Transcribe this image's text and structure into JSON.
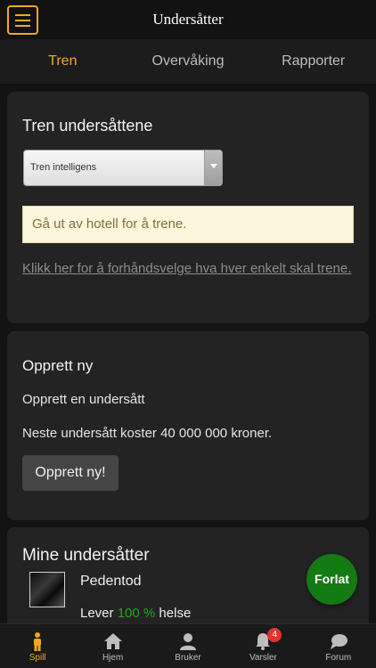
{
  "header": {
    "title": "Undersåtter"
  },
  "tabs": [
    {
      "label": "Tren"
    },
    {
      "label": "Overvåking"
    },
    {
      "label": "Rapporter"
    }
  ],
  "train": {
    "title": "Tren undersåttene",
    "select_value": "Tren intelligens",
    "notice": "Gå ut av hotell for å trene.",
    "preselect_link": "Klikk her for å forhåndsvelge hva hver enkelt skal trene."
  },
  "create": {
    "title": "Opprett ny",
    "subtitle": "Opprett en undersått",
    "cost_text": "Neste undersått koster 40 000 000 kroner.",
    "button_label": "Opprett ny!"
  },
  "mine": {
    "title": "Mine undersåtter",
    "subject_name": "Pedentod",
    "status_prefix": "Lever",
    "health_pct": "100 %",
    "status_suffix": "helse"
  },
  "fab": {
    "label": "Forlat"
  },
  "bottom_nav": [
    {
      "label": "Spill",
      "icon": "person-icon"
    },
    {
      "label": "Hjem",
      "icon": "home-icon"
    },
    {
      "label": "Bruker",
      "icon": "user-icon"
    },
    {
      "label": "Varsler",
      "icon": "bell-icon",
      "badge": "4"
    },
    {
      "label": "Forum",
      "icon": "chat-icon"
    }
  ],
  "colors": {
    "accent": "#f5a623",
    "health": "#23a623",
    "fab": "#147a14",
    "badge": "#e0342c"
  }
}
